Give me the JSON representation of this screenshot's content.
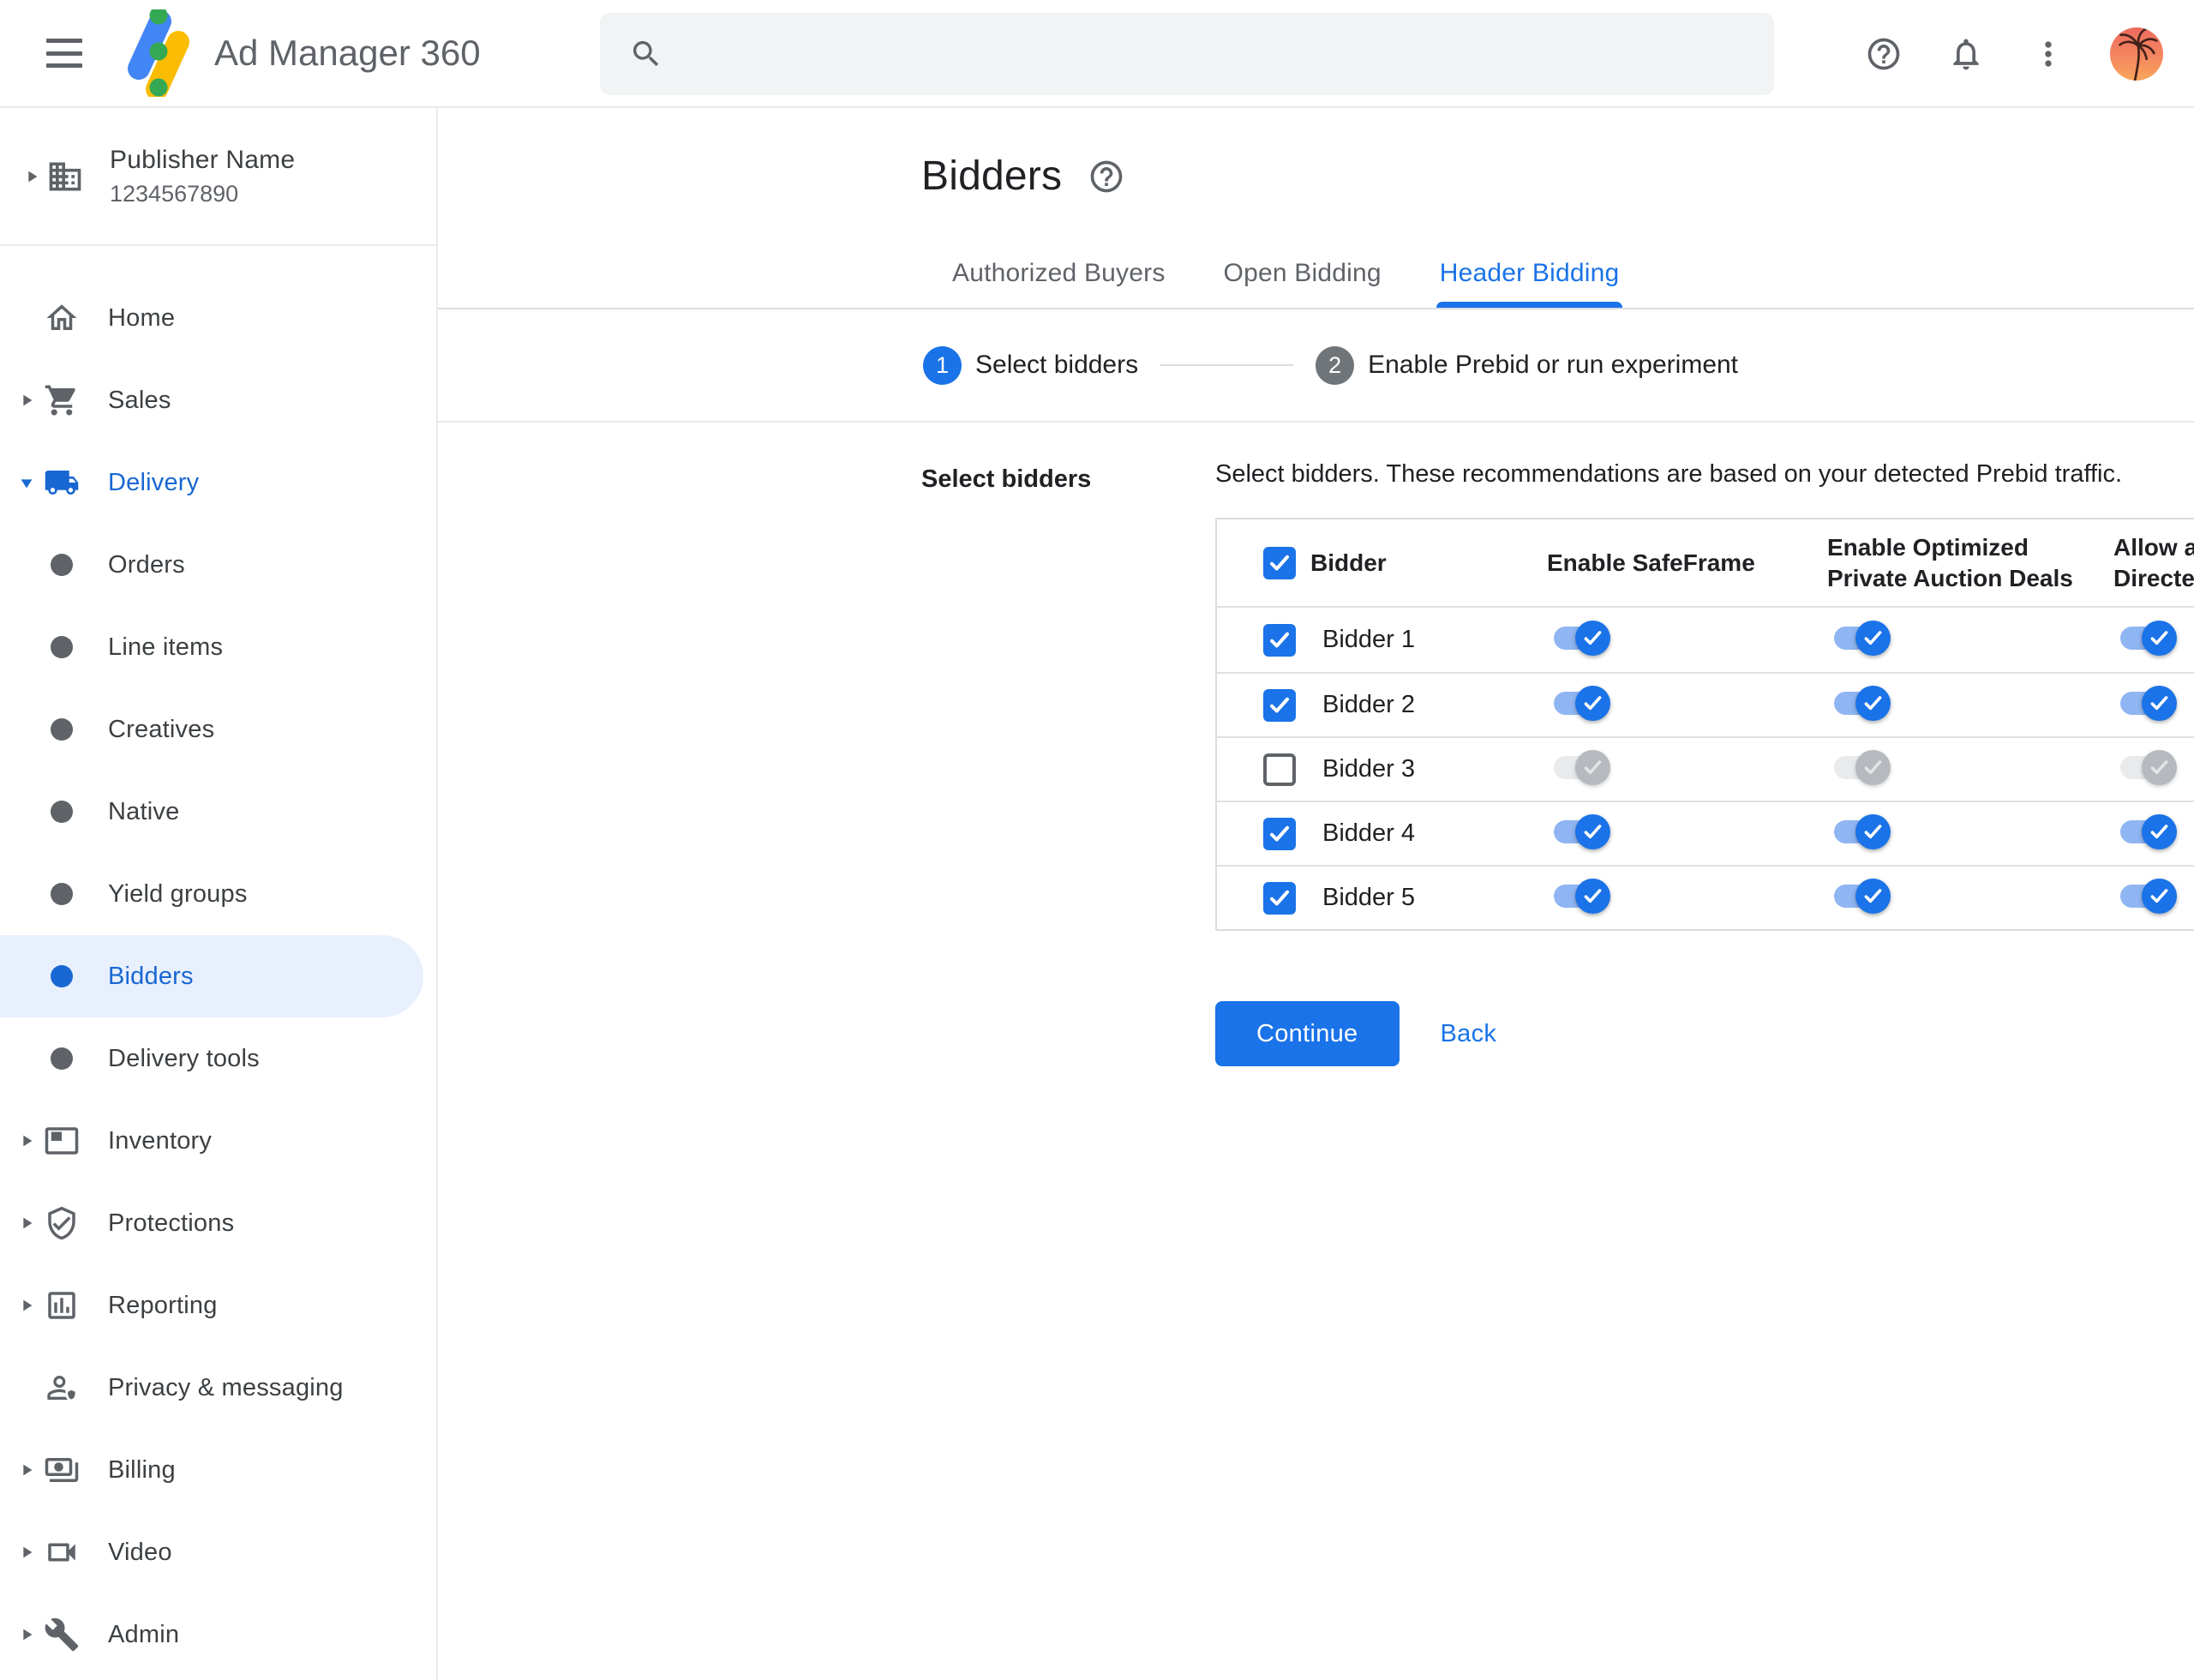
{
  "topbar": {
    "app_name": "Ad Manager 360",
    "search": {
      "value": "",
      "placeholder": ""
    }
  },
  "sidebar": {
    "publisher": {
      "name": "Publisher Name",
      "id": "1234567890"
    },
    "items": [
      {
        "id": "home",
        "label": "Home",
        "icon": "home-icon",
        "arrow": "none",
        "level": "top"
      },
      {
        "id": "sales",
        "label": "Sales",
        "icon": "cart-icon",
        "arrow": "collapsed",
        "level": "top"
      },
      {
        "id": "delivery",
        "label": "Delivery",
        "icon": "truck-icon",
        "arrow": "expanded",
        "level": "top",
        "highlight": true
      },
      {
        "id": "orders",
        "label": "Orders",
        "icon": "bullet-icon",
        "arrow": "none",
        "level": "sub"
      },
      {
        "id": "line-items",
        "label": "Line items",
        "icon": "bullet-icon",
        "arrow": "none",
        "level": "sub"
      },
      {
        "id": "creatives",
        "label": "Creatives",
        "icon": "bullet-icon",
        "arrow": "none",
        "level": "sub"
      },
      {
        "id": "native",
        "label": "Native",
        "icon": "bullet-icon",
        "arrow": "none",
        "level": "sub"
      },
      {
        "id": "yield-groups",
        "label": "Yield groups",
        "icon": "bullet-icon",
        "arrow": "none",
        "level": "sub"
      },
      {
        "id": "bidders",
        "label": "Bidders",
        "icon": "bullet-icon",
        "arrow": "none",
        "level": "sub",
        "active": true
      },
      {
        "id": "delivery-tools",
        "label": "Delivery tools",
        "icon": "bullet-icon",
        "arrow": "none",
        "level": "sub"
      },
      {
        "id": "inventory",
        "label": "Inventory",
        "icon": "inventory-icon",
        "arrow": "collapsed",
        "level": "top"
      },
      {
        "id": "protections",
        "label": "Protections",
        "icon": "shield-check-icon",
        "arrow": "collapsed",
        "level": "top"
      },
      {
        "id": "reporting",
        "label": "Reporting",
        "icon": "bar-chart-icon",
        "arrow": "collapsed",
        "level": "top"
      },
      {
        "id": "privacy-messaging",
        "label": "Privacy & messaging",
        "icon": "person-shield-icon",
        "arrow": "none",
        "level": "top"
      },
      {
        "id": "billing",
        "label": "Billing",
        "icon": "payments-icon",
        "arrow": "collapsed",
        "level": "top"
      },
      {
        "id": "video",
        "label": "Video",
        "icon": "videocam-icon",
        "arrow": "collapsed",
        "level": "top"
      },
      {
        "id": "admin",
        "label": "Admin",
        "icon": "wrench-icon",
        "arrow": "collapsed",
        "level": "top"
      }
    ]
  },
  "main": {
    "title": "Bidders",
    "tabs": [
      {
        "label": "Authorized Buyers",
        "active": false
      },
      {
        "label": "Open Bidding",
        "active": false
      },
      {
        "label": "Header Bidding",
        "active": true
      }
    ],
    "steps": [
      {
        "number": "1",
        "label": "Select bidders",
        "state": "current"
      },
      {
        "number": "2",
        "label": "Enable Prebid or run experiment",
        "state": "upcoming"
      }
    ],
    "section_label": "Select bidders",
    "description": "Select bidders. These recommendations are based on your detected Prebid traffic.",
    "table": {
      "select_all_checked": true,
      "columns": [
        "Bidder",
        "Enable SafeFrame",
        "Enable Optimized Private Auction Deals",
        "Allow ads on Child-Directed Requests"
      ],
      "rows": [
        {
          "name": "Bidder 1",
          "checked": true,
          "enable_safeframe": "on",
          "enable_optimized_private_auction_deals": "on",
          "allow_ads_on_child_directed_requests": "on"
        },
        {
          "name": "Bidder 2",
          "checked": true,
          "enable_safeframe": "on",
          "enable_optimized_private_auction_deals": "on",
          "allow_ads_on_child_directed_requests": "on"
        },
        {
          "name": "Bidder 3",
          "checked": false,
          "enable_safeframe": "disabled",
          "enable_optimized_private_auction_deals": "disabled",
          "allow_ads_on_child_directed_requests": "disabled"
        },
        {
          "name": "Bidder 4",
          "checked": true,
          "enable_safeframe": "on",
          "enable_optimized_private_auction_deals": "on",
          "allow_ads_on_child_directed_requests": "on"
        },
        {
          "name": "Bidder 5",
          "checked": true,
          "enable_safeframe": "on",
          "enable_optimized_private_auction_deals": "on",
          "allow_ads_on_child_directed_requests": "on"
        }
      ]
    },
    "continue_label": "Continue",
    "back_label": "Back"
  },
  "colors": {
    "accent_blue": "#1a73e8",
    "active_nav_blue": "#1967d2",
    "selected_item_bg": "#e8f0fe",
    "toggle_track_on": "#8fb5f2",
    "toggle_track_disabled": "#e9eaec",
    "toggle_thumb_disabled": "#b6babe",
    "step_upcoming_gray": "#70757a",
    "logo_blue": "#4285f4",
    "logo_yellow": "#fbbc04",
    "logo_green": "#34a853"
  }
}
